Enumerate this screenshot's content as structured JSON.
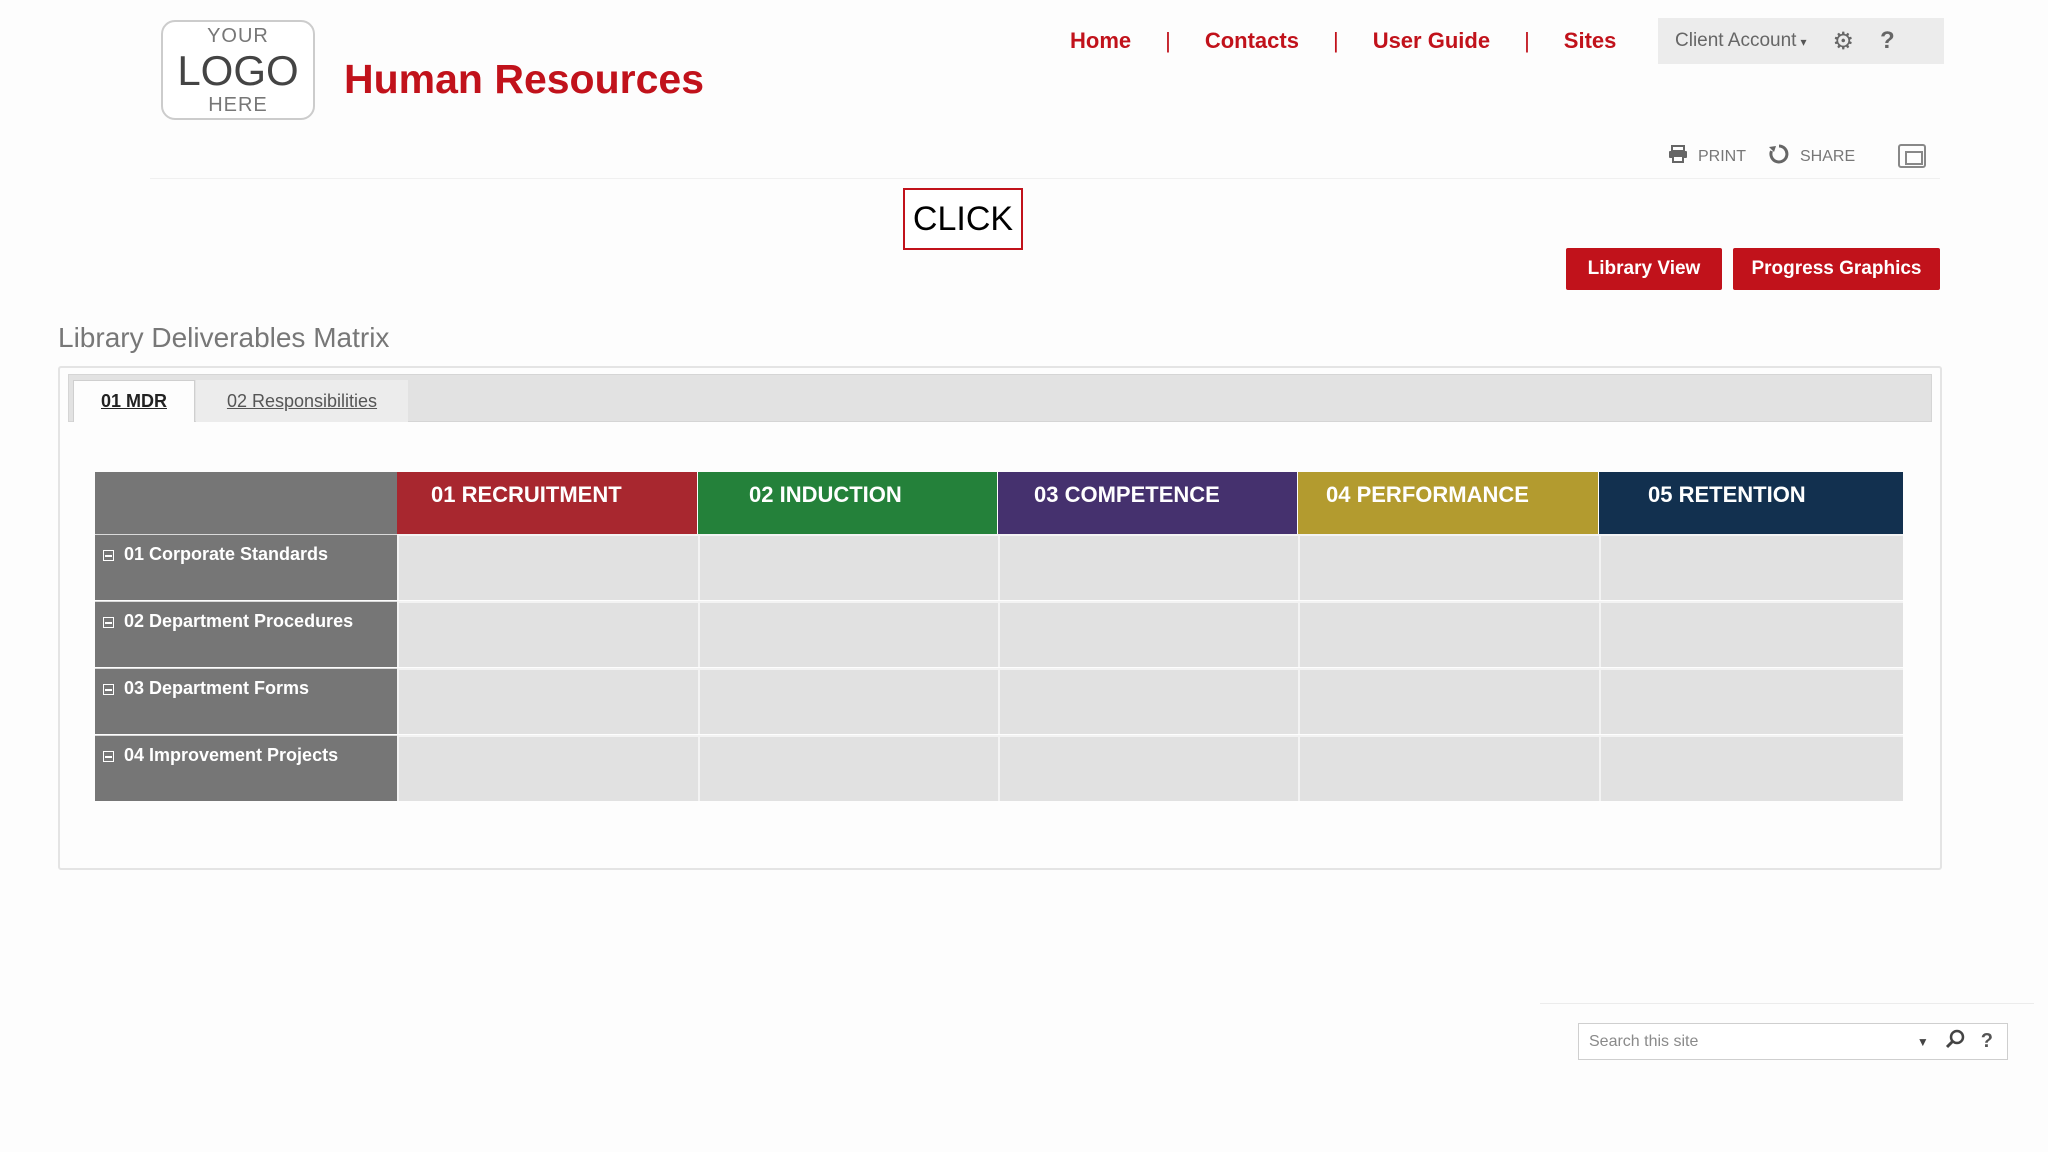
{
  "logo": {
    "line1": "YOUR",
    "line2": "LOGO",
    "line3": "HERE"
  },
  "site_title": "Human Resources",
  "top_nav": {
    "links": [
      "Home",
      "Contacts",
      "User Guide",
      "Sites"
    ],
    "separator": "|"
  },
  "account": {
    "label": "Client Account",
    "caret": "▾",
    "gear_icon": "⚙",
    "help_icon": "?"
  },
  "tools": {
    "print_label": "PRINT",
    "share_label": "SHARE"
  },
  "callout": "CLICK",
  "buttons": {
    "library_view": "Library View",
    "progress_graphics": "Progress Graphics"
  },
  "section_title": "Library Deliverables Matrix",
  "tabs": [
    {
      "label": "01 MDR",
      "active": true
    },
    {
      "label": "02 Responsibilities",
      "active": false
    }
  ],
  "matrix": {
    "columns": [
      {
        "label": "01 RECRUITMENT",
        "color": "#a8272f"
      },
      {
        "label": "02 INDUCTION",
        "color": "#24813a"
      },
      {
        "label": "03 COMPETENCE",
        "color": "#45316e"
      },
      {
        "label": "04 PERFORMANCE",
        "color": "#b39b2f"
      },
      {
        "label": "05 RETENTION",
        "color": "#12304f"
      }
    ],
    "rows": [
      "01 Corporate Standards",
      "02 Department Procedures",
      "03 Department Forms",
      "04 Improvement Projects"
    ]
  },
  "search": {
    "placeholder": "Search this site",
    "dropdown_icon": "▼",
    "help_icon": "?"
  },
  "colors": {
    "brand_red": "#c1121b"
  }
}
